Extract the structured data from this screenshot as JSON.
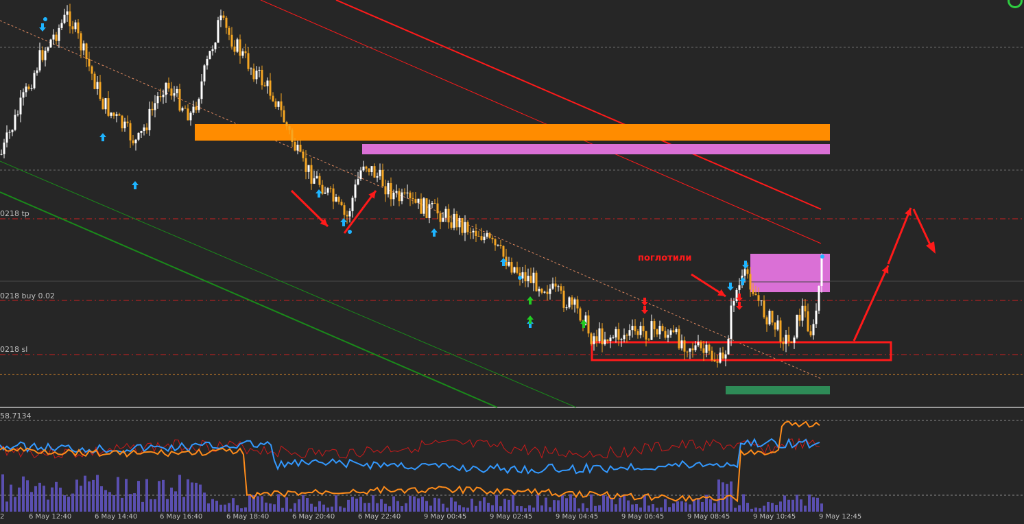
{
  "levels": {
    "tp_label": "0218 tp",
    "buy_label": "0218 buy 0.02",
    "sl_label": "0218 sl"
  },
  "annotation": {
    "absorbed": "поглотили"
  },
  "subwindow": {
    "value_label": "58.7134"
  },
  "time_axis": [
    "2",
    "6 May 12:40",
    "6 May 14:40",
    "6 May 16:40",
    "6 May 18:40",
    "6 May 20:40",
    "6 May 22:40",
    "9 May 00:45",
    "9 May 02:45",
    "9 May 04:45",
    "9 May 06:45",
    "9 May 08:45",
    "9 May 10:45",
    "9 May 12:45"
  ],
  "colors": {
    "background": "#262626",
    "bull_candle": "#ffffff",
    "bear_candle": "#f5a623",
    "supply_zone": "#ff8c00",
    "fvg_zone": "#da70d6",
    "demand_zone": "#2e8b57",
    "trend_red": "#ff1a1a",
    "trend_green": "#1a8a1a",
    "arrow_blue": "#1eb4ff",
    "arrow_green": "#22cc22",
    "osc_blue": "#3399ff",
    "osc_orange": "#ff8c1a",
    "osc_red": "#cc1a1a",
    "volume": "#5a4fb0"
  },
  "icons": [
    "corner-logo-icon",
    "up-arrow-icon",
    "down-arrow-icon",
    "annotation-arrow-icon"
  ]
}
